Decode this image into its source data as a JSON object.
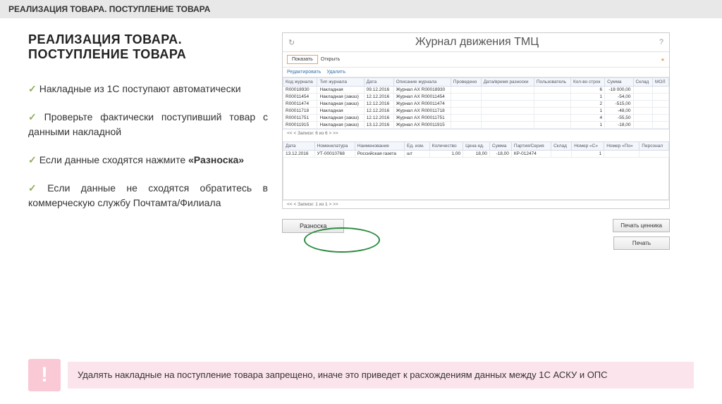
{
  "top_bar": "РЕАЛИЗАЦИЯ ТОВАРА. ПОСТУПЛЕНИЕ ТОВАРА",
  "heading": "РЕАЛИЗАЦИЯ ТОВАРА. ПОСТУПЛЕНИЕ ТОВАРА",
  "bullets": {
    "b1a": "Накладные из 1С поступают автоматически",
    "b2a": "Проверьте фактически поступивший товар с данными накладной",
    "b3a": "Если данные сходятся нажмите ",
    "b3b": "«Разноска»",
    "b4a": "Если данные не сходятся обратитесь в коммерческую службу Почтамта/Филиала"
  },
  "app": {
    "title": "Журнал движения ТМЦ",
    "toolbar1": {
      "show": "Показать",
      "open": "Открыть"
    },
    "toolbar2": {
      "edit": "Редактировать",
      "delete": "Удалить"
    },
    "cols": {
      "c1": "Код журнала",
      "c2": "Тип журнала",
      "c3": "Дата",
      "c4": "Описание журнала",
      "c5": "Проведено",
      "c6": "Дата/время разноски",
      "c7": "Пользователь",
      "c8": "Кол-во строк",
      "c9": "Сумма",
      "c10": "Склад",
      "c11": "МОЛ"
    },
    "rows": [
      {
        "code": "R00018930",
        "type": "Накладная",
        "date": "09.12.2016",
        "desc": "Журнал АХ R00018930",
        "qty": "6",
        "sum": "-18 000,00"
      },
      {
        "code": "R00011454",
        "type": "Накладная (заказ)",
        "date": "12.12.2016",
        "desc": "Журнал АХ R00011454",
        "qty": "1",
        "sum": "-54,00"
      },
      {
        "code": "R00011474",
        "type": "Накладная (заказ)",
        "date": "12.12.2016",
        "desc": "Журнал АХ R00011474",
        "qty": "2",
        "sum": "-515,00"
      },
      {
        "code": "R00011718",
        "type": "Накладная",
        "date": "12.12.2016",
        "desc": "Журнал АХ R00011718",
        "qty": "1",
        "sum": "-48,00"
      },
      {
        "code": "R00011751",
        "type": "Накладная (заказ)",
        "date": "12.12.2016",
        "desc": "Журнал АХ R00011751",
        "qty": "4",
        "sum": "-55,50"
      },
      {
        "code": "R00011915",
        "type": "Накладная (заказ)",
        "date": "13.12.2016",
        "desc": "Журнал АХ R00011915",
        "qty": "1",
        "sum": "-18,00"
      }
    ],
    "footer": {
      "range": "Записи: 6 из 6",
      "nav1": "<<",
      "nav2": "<",
      "nav3": ">",
      "nav4": ">>"
    },
    "dcols": {
      "c1": "Дата",
      "c2": "Номенклатура",
      "c3": "Наименование",
      "c4": "Ед. изм.",
      "c5": "Количество",
      "c6": "Цена ед.",
      "c7": "Сумма",
      "c8": "Партия/Серия",
      "c9": "Склад",
      "c10": "Номер «С»",
      "c11": "Номер «По»",
      "c12": "Персонал"
    },
    "drow": {
      "date": "13.12.2016",
      "nom": "УТ-00010768",
      "name": "Российская газета",
      "unit": "шт",
      "qty": "1,00",
      "price": "18,00",
      "sum": "-18,00",
      "batch": "КР-012474",
      "x": "1"
    },
    "dfooter": "Записи: 1 из 1",
    "bottom": {
      "raznoska": "Разноска",
      "print_tag": "Печать ценника",
      "print": "Печать"
    }
  },
  "warning": "Удалять накладные на поступление товара запрещено, иначе это приведет к расхождениям данных между 1С АСКУ и ОПС"
}
